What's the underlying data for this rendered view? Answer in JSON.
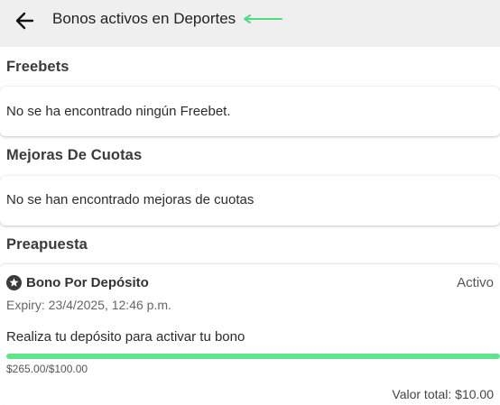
{
  "header": {
    "title": "Bonos activos en Deportes",
    "back_icon": "arrow-left-icon",
    "annotation_icon": "arrow-pointer-left-icon",
    "annotation_color": "#4ade80"
  },
  "sections": {
    "freebets": {
      "title": "Freebets",
      "empty_message": "No se ha encontrado ningún Freebet."
    },
    "odds_boosts": {
      "title": "Mejoras De Cuotas",
      "empty_message": "No se han encontrado mejoras de cuotas"
    },
    "prebet": {
      "title": "Preapuesta",
      "bonus": {
        "icon": "star-icon",
        "title": "Bono Por Depósito",
        "status": "Activo",
        "expiry": "Expiry: 23/4/2025, 12:46 p.m.",
        "instruction": "Realiza tu depósito para activar tu bono",
        "progress_label": "$265.00/$100.00",
        "progress_fraction": 1.0,
        "progress_color": "#5fe68c",
        "total": "Valor total: $10.00"
      }
    }
  }
}
